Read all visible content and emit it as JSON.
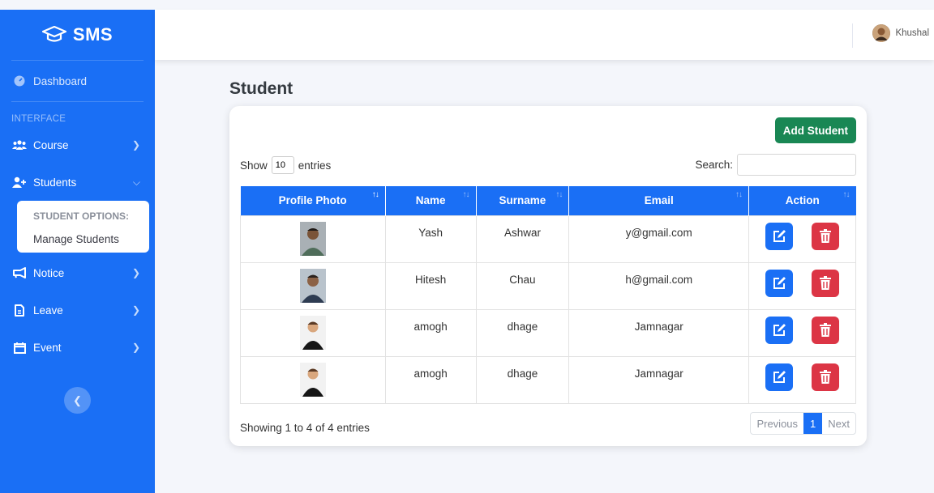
{
  "brand": {
    "name": "SMS",
    "icon": "graduation-cap-icon"
  },
  "sidebar": {
    "dashboard": "Dashboard",
    "heading": "INTERFACE",
    "items": [
      {
        "label": "Course",
        "icon": "users-group-icon"
      },
      {
        "label": "Students",
        "icon": "user-plus-icon"
      },
      {
        "label": "Notice",
        "icon": "bullhorn-icon"
      },
      {
        "label": "Leave",
        "icon": "file-icon"
      },
      {
        "label": "Event",
        "icon": "calendar-icon"
      }
    ],
    "submenu": {
      "heading": "STUDENT OPTIONS:",
      "item": "Manage Students"
    }
  },
  "topbar": {
    "user_name": "Khushal"
  },
  "page": {
    "title": "Student"
  },
  "card": {
    "add_button": "Add Student",
    "show_label": "Show",
    "entries_label": "entries",
    "entries_value": "10",
    "search_label": "Search:",
    "search_value": "",
    "info": "Showing 1 to 4 of 4 entries",
    "pager": {
      "previous": "Previous",
      "current": "1",
      "next": "Next"
    }
  },
  "table": {
    "columns": [
      "Profile Photo",
      "Name",
      "Surname",
      "Email",
      "Action"
    ],
    "rows": [
      {
        "name": "Yash",
        "surname": "Ashwar",
        "email": "y@gmail.com"
      },
      {
        "name": "Hitesh",
        "surname": "Chau",
        "email": "h@gmail.com"
      },
      {
        "name": "amogh",
        "surname": "dhage",
        "email": "Jamnagar"
      },
      {
        "name": "amogh",
        "surname": "dhage",
        "email": "Jamnagar"
      }
    ]
  },
  "colors": {
    "primary": "#1a6ff5",
    "success": "#198754",
    "danger": "#dc3545"
  }
}
